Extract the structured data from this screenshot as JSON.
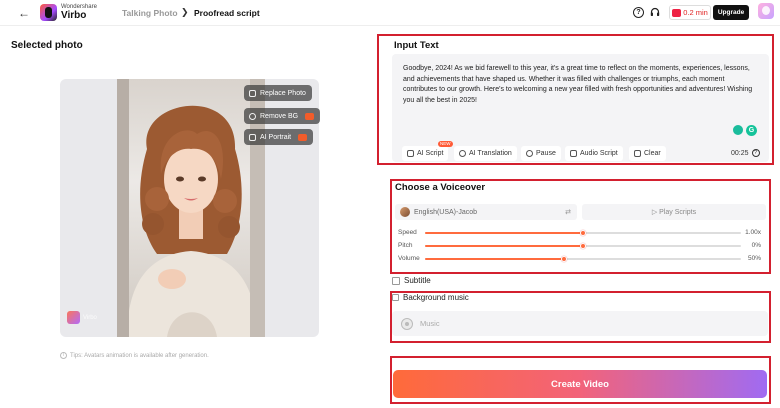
{
  "header": {
    "back_icon": "arrow-left-icon",
    "brand_small": "Wondershare",
    "brand_name": "Virbo",
    "breadcrumb": [
      "Talking Photo",
      "Proofread script"
    ],
    "credits": "0.2 min",
    "upgrade_label": "Upgrade"
  },
  "left": {
    "title": "Selected photo",
    "photo_buttons": [
      {
        "label": "Replace Photo",
        "icon": "swap-icon"
      },
      {
        "label": "Remove BG",
        "icon": "cutout-icon"
      },
      {
        "label": "AI Portrait",
        "icon": "portrait-icon"
      }
    ],
    "watermark": "Virbo",
    "tips": "Tips: Avatars animation is available after generation."
  },
  "input_text": {
    "title": "Input Text",
    "script": "Goodbye, 2024! As we bid farewell to this year, it's a great time to reflect on the moments, experiences, lessons, and achievements that have shaped us. Whether it was filled with challenges or triumphs, each moment contributes to our growth. Here's to welcoming a new year filled with fresh opportunities and adventures! Wishing you all the best in 2025!",
    "tools": [
      "AI Script",
      "AI Translation",
      "Pause",
      "Audio Script",
      "Clear"
    ],
    "new_badge": "NEW",
    "duration": "00:25",
    "grammar_badge": "G"
  },
  "voiceover": {
    "title": "Choose a Voiceover",
    "voice": "English(USA)-Jacob",
    "play_label": "Play Scripts",
    "sliders": [
      {
        "label": "Speed",
        "value_text": "1.00x",
        "fraction": 0.5
      },
      {
        "label": "Pitch",
        "value_text": "0%",
        "fraction": 0.5
      },
      {
        "label": "Volume",
        "value_text": "50%",
        "fraction": 0.44
      }
    ]
  },
  "options": {
    "subtitle_label": "Subtitle",
    "bgm_label": "Background music",
    "music_placeholder": "Music"
  },
  "create_label": "Create Video",
  "colors": {
    "accent": "#ff6b3d",
    "highlight_frame": "#d3202f",
    "upgrade_bg": "#111111"
  }
}
